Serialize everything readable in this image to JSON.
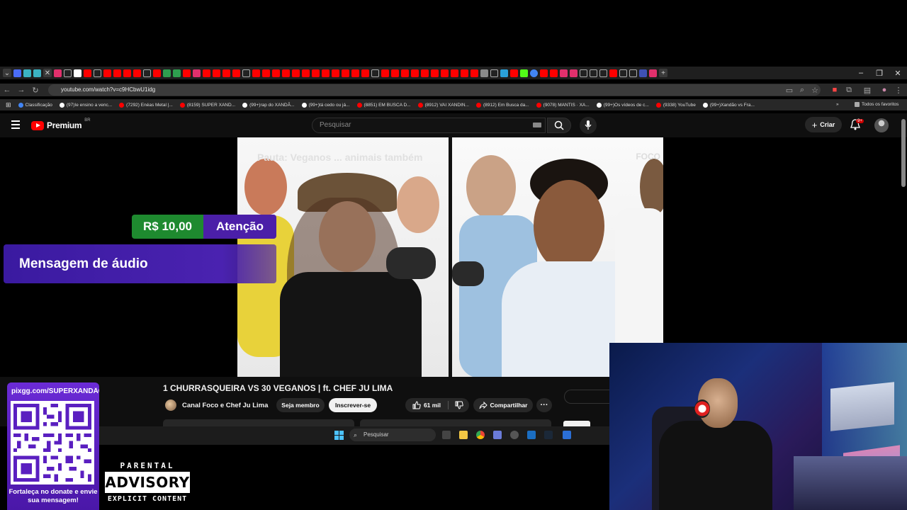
{
  "browser": {
    "url": "youtube.com/watch?v=c9HCbwU1idg",
    "bookmarks": [
      {
        "label": "Classificação",
        "color": "#4285f4"
      },
      {
        "label": "(97)Ie ensino a venc...",
        "color": "#ffffff"
      },
      {
        "label": "(7292) Enéas Metal |...",
        "color": "#ff0000"
      },
      {
        "label": "(8159) SUPER XAND...",
        "color": "#ff0000"
      },
      {
        "label": "(99+)rap do XANDÃ...",
        "color": "#ffffff"
      },
      {
        "label": "(99+)tá cedo ou já...",
        "color": "#ffffff"
      },
      {
        "label": "(8851) EM BUSCA D...",
        "color": "#ff0000"
      },
      {
        "label": "(8912) VAI XANDIN...",
        "color": "#ff0000"
      },
      {
        "label": "(8912) Em Busca da...",
        "color": "#ff0000"
      },
      {
        "label": "(9078) MANTIS · XA...",
        "color": "#ff0000"
      },
      {
        "label": "(99+)Os vídeos de c...",
        "color": "#ffffff"
      },
      {
        "label": "(9338) YouTube",
        "color": "#ff0000"
      },
      {
        "label": "(99+)Xandão vs Fra...",
        "color": "#ffffff"
      }
    ],
    "all_bookmarks_label": "Todos os favoritos"
  },
  "youtube": {
    "logo_text": "Premium",
    "logo_region": "BR",
    "search_placeholder": "Pesquisar",
    "create_label": "Criar",
    "notification_count": "9+"
  },
  "video": {
    "overlay_text": "Pauta: Veganos ... animais também",
    "brand_text": "FOCO",
    "title": "1 CHURRASQUEIRA VS 30 VEGANOS | ft. CHEF JU LIMA",
    "channel": "Canal Foco e Chef Ju Lima",
    "member_label": "Seja membro",
    "subscribe_label": "Inscrever-se",
    "likes": "61 mil",
    "share_label": "Compartilhar",
    "more_label": "···"
  },
  "donation": {
    "amount": "R$ 10,00",
    "tag": "Atenção",
    "message": "Mensagem de áudio"
  },
  "taskbar": {
    "search_placeholder": "Pesquisar"
  },
  "qr_overlay": {
    "url": "pixgg.com/SUPERXANDÃO",
    "caption": "Fortaleça no donate e envie sua mensagem!"
  },
  "parental_advisory": {
    "top": "PARENTAL",
    "middle": "ADVISORY",
    "bottom": "EXPLICIT CONTENT"
  },
  "colors": {
    "youtube_red": "#ff0000",
    "donation_green": "#1e8a2f",
    "donation_purple": "#4b1fa8",
    "qr_purple": "#6b2bd6"
  }
}
